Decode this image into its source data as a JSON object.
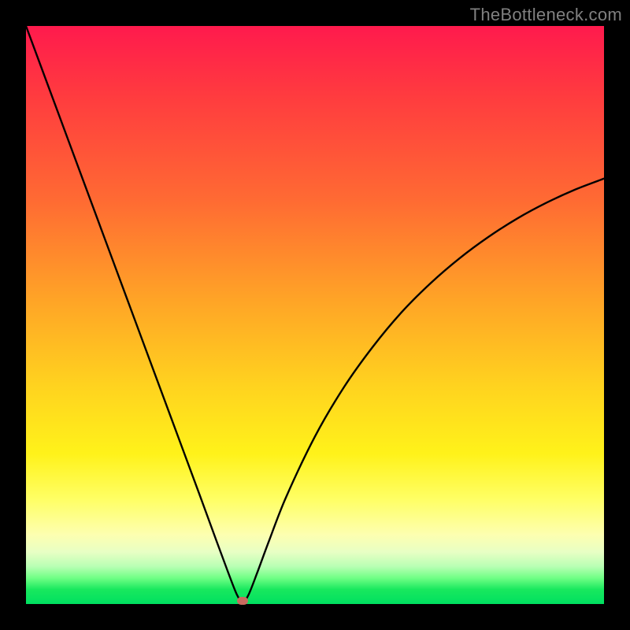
{
  "watermark": "TheBottleneck.com",
  "chart_data": {
    "type": "line",
    "title": "",
    "xlabel": "",
    "ylabel": "",
    "xlim": [
      0,
      100
    ],
    "ylim": [
      0,
      100
    ],
    "grid": false,
    "series": [
      {
        "name": "bottleneck-curve",
        "x": [
          0,
          5,
          10,
          15,
          20,
          25,
          30,
          33,
          35,
          36.5,
          37.5,
          38.5,
          40,
          42,
          45,
          50,
          55,
          60,
          65,
          70,
          75,
          80,
          85,
          90,
          95,
          100
        ],
        "values": [
          100,
          86.5,
          73,
          59.5,
          46,
          32.5,
          19,
          10.8,
          5.4,
          1.6,
          0.3,
          1.6,
          5.4,
          10.8,
          18.5,
          29,
          37.5,
          44.5,
          50.5,
          55.5,
          59.8,
          63.5,
          66.7,
          69.4,
          71.7,
          73.6
        ]
      }
    ],
    "marker": {
      "x": 37.5,
      "y": 0.5
    },
    "background_gradient": {
      "top": "#ff1a4d",
      "upper_mid": "#ffa626",
      "mid": "#fff21a",
      "lower_mid": "#fdffb0",
      "bottom": "#00e060"
    }
  }
}
